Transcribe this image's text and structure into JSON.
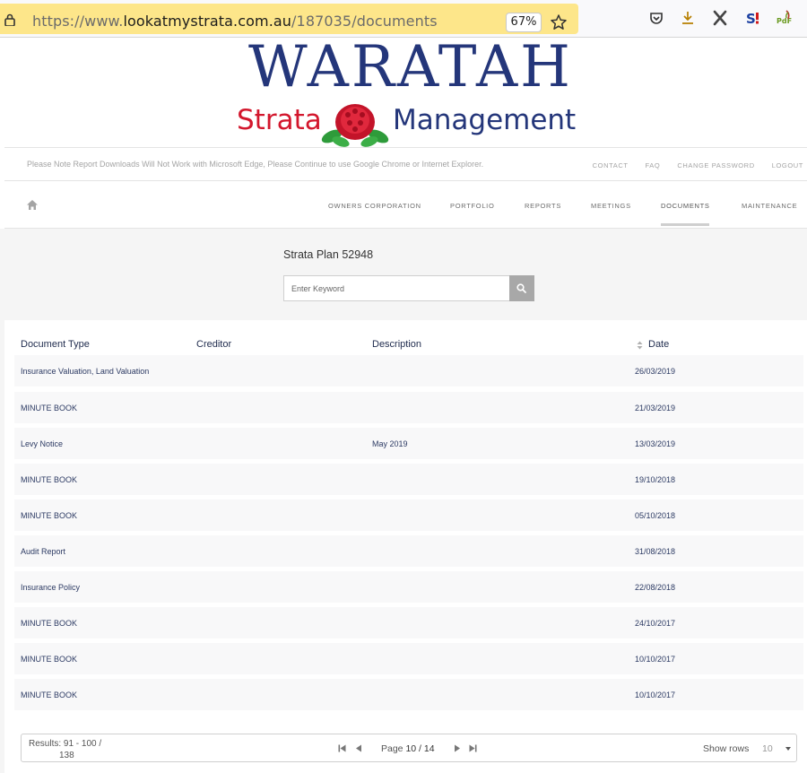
{
  "browser": {
    "url_prefix": "https://www.",
    "url_domain": "lookatmystrata.com.au",
    "url_path": "/187035/documents",
    "zoom": "67%"
  },
  "logo": {
    "title": "WARATAH",
    "line_left": "Strata",
    "line_right": "Management"
  },
  "notice": "Please Note Report Downloads Will Not Work with Microsoft Edge, Please Continue to use Google Chrome or Internet Explorer.",
  "top_links": [
    "CONTACT",
    "FAQ",
    "CHANGE PASSWORD",
    "LOGOUT"
  ],
  "nav": {
    "items": [
      "OWNERS CORPORATION",
      "PORTFOLIO",
      "REPORTS",
      "MEETINGS",
      "DOCUMENTS",
      "MAINTENANCE"
    ],
    "active": "DOCUMENTS"
  },
  "plan_title": "Strata Plan 52948",
  "search": {
    "placeholder": "Enter Keyword"
  },
  "table": {
    "headers": [
      "Document Type",
      "Creditor",
      "Description",
      "Date"
    ],
    "rows": [
      {
        "type": "Insurance Valuation, Land Valuation",
        "creditor": "",
        "description": "",
        "date": "26/03/2019"
      },
      {
        "type": "MINUTE BOOK",
        "creditor": "",
        "description": "",
        "date": "21/03/2019"
      },
      {
        "type": "Levy Notice",
        "creditor": "",
        "description": "May 2019",
        "date": "13/03/2019"
      },
      {
        "type": "MINUTE BOOK",
        "creditor": "",
        "description": "",
        "date": "19/10/2018"
      },
      {
        "type": "MINUTE BOOK",
        "creditor": "",
        "description": "",
        "date": "05/10/2018"
      },
      {
        "type": "Audit Report",
        "creditor": "",
        "description": "",
        "date": "31/08/2018"
      },
      {
        "type": "Insurance Policy",
        "creditor": "",
        "description": "",
        "date": "22/08/2018"
      },
      {
        "type": "MINUTE BOOK",
        "creditor": "",
        "description": "",
        "date": "24/10/2017"
      },
      {
        "type": "MINUTE BOOK",
        "creditor": "",
        "description": "",
        "date": "10/10/2017"
      },
      {
        "type": "MINUTE BOOK",
        "creditor": "",
        "description": "",
        "date": "10/10/2017"
      }
    ]
  },
  "pager": {
    "results_line1": "Results: 91 - 100 /",
    "results_line2": "138",
    "page_prefix": "Page",
    "page_value": "10 / 14",
    "show_rows_label": "Show rows",
    "rows_value": "10"
  },
  "colors": {
    "url_highlight": "#fde68a",
    "logo_blue": "#24367a",
    "logo_red": "#d3172d",
    "table_text": "#2c3a63"
  }
}
